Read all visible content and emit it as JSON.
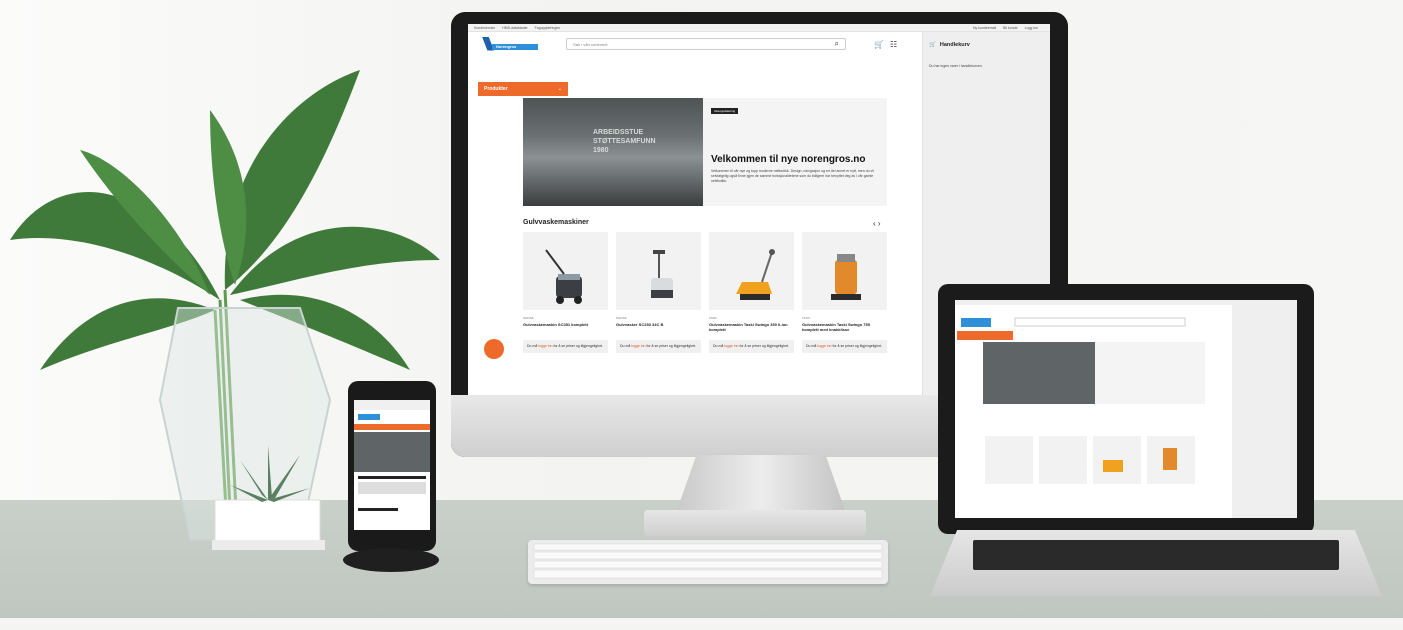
{
  "site": {
    "topbar_left": [
      "Kundeservice",
      "HMS-datablader",
      "Fagopplæringen"
    ],
    "topbar_right": [
      "Ny kundeemail",
      "Bli kunde",
      "Logg inn"
    ],
    "logo_text": "Norengros",
    "search_placeholder": "Søk i vårt sortiment",
    "products_button": "Produkter",
    "cart_title": "Handlekurv",
    "cart_empty": "Du har ingen varer i handlekurven.",
    "hero_badge": "Ukeoppdatering",
    "hero_title": "Velkommen til nye norengros.no",
    "hero_body": "Velkommen til vår nye og topp moderne nettbutikk. Design, navigasjon og en del annet er nytt, men du vil selvfølgelig også finne igjen de samme funksjonalitetene som du tidligere har benyttet deg av i vår gamle nettbutikk.",
    "hero_sign": [
      "ARBEIDSSTUE",
      "STØTTESAMFUNN",
      "1980"
    ],
    "section_title": "Gulvvaskemaskiner",
    "products": [
      {
        "brand": "NILFISK",
        "name": "Gulvvaskemaskin SC351 komplett",
        "login_pre": "Du må ",
        "login_link": "logge inn",
        "login_post": " for å se priser og tilgjengelighet."
      },
      {
        "brand": "NILFISK",
        "name": "Gulvvasker SC250 34C B",
        "login_pre": "Du må ",
        "login_link": "logge inn",
        "login_post": " for å se priser og tilgjengelighet."
      },
      {
        "brand": "TASKI",
        "name": "Gulvvaskemaskin Taski Swingo 350 li-ion komplett",
        "login_pre": "Du må ",
        "login_link": "logge inn",
        "login_post": " for å se priser og tilgjengelighet."
      },
      {
        "brand": "TASKI",
        "name": "Gulvvaskemaskin Taski Swingo 755 komplett med knakklisse",
        "login_pre": "Du må ",
        "login_link": "logge inn",
        "login_post": " for å se priser og tilgjengelighet."
      }
    ]
  },
  "colors": {
    "brand_blue": "#2f8fd8",
    "brand_orange": "#ee6a2a"
  }
}
